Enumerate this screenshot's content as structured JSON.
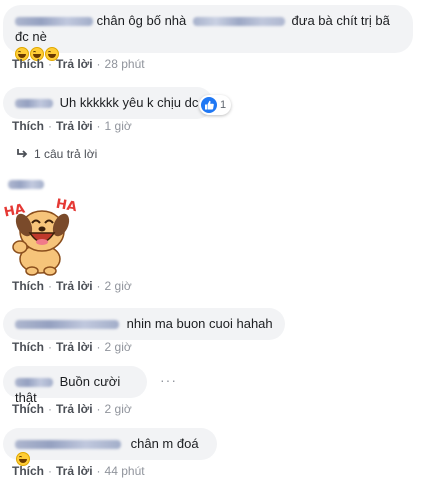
{
  "comments": [
    {
      "text_parts": [
        "chân ôg bố nhà",
        "đưa bà chít trị bã đc nè"
      ],
      "emoji": [
        "grinning-sweat",
        "grinning-sweat",
        "grinning-sweat"
      ],
      "actions": {
        "like": "Thích",
        "reply": "Trả lời",
        "time": "28 phút"
      }
    },
    {
      "text": "Uh kkkkkk yêu k chịu dc",
      "reaction_count": "1",
      "actions": {
        "like": "Thích",
        "reply": "Trả lời",
        "time": "1 giờ"
      },
      "replies_label": "1 câu trả lời"
    },
    {
      "sticker": "ha-ha-dog-sticker",
      "sticker_text_left": "HA",
      "sticker_text_right": "HA",
      "actions": {
        "like": "Thích",
        "reply": "Trả lời",
        "time": "2 giờ"
      }
    },
    {
      "text": "nhin ma buon cuoi hahah",
      "actions": {
        "like": "Thích",
        "reply": "Trả lời",
        "time": "2 giờ"
      }
    },
    {
      "text": "Buồn cười thật",
      "more": "···",
      "actions": {
        "like": "Thích",
        "reply": "Trả lời",
        "time": "2 giờ"
      }
    },
    {
      "text": "chân m đoá",
      "emoji": [
        "grinning-sweat"
      ],
      "actions": {
        "like": "Thích",
        "reply": "Trả lời",
        "time": "44 phút"
      }
    }
  ],
  "colors": {
    "bubble": "#f2f3f5",
    "link": "#4b4f56",
    "meta": "#90949c",
    "like_blue": "#2078f4"
  }
}
